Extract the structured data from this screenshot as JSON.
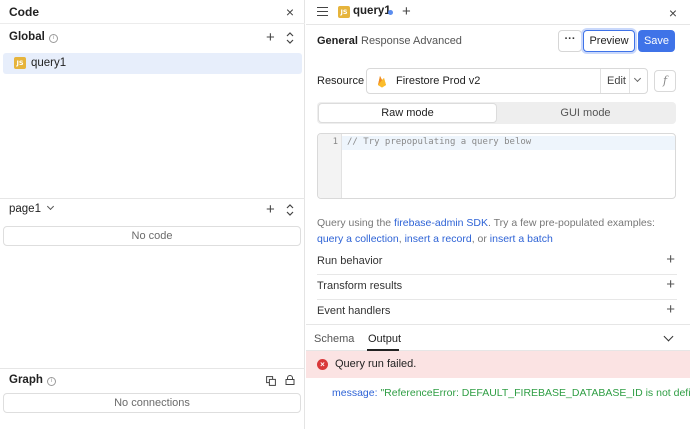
{
  "left_panel": {
    "title": "Code",
    "close_glyph": "×",
    "global_section": {
      "label": "Global",
      "info_glyph": "i"
    },
    "global_items": [
      {
        "badge": "JS",
        "label": "query1"
      }
    ],
    "page_section": {
      "label": "page1",
      "empty_text": "No code"
    },
    "graph_section": {
      "label": "Graph",
      "info_glyph": "i",
      "empty_text": "No connections"
    },
    "plus_glyph": "+"
  },
  "query_editor": {
    "tab": {
      "badge": "JS",
      "label": "query1",
      "add_glyph": "+",
      "close_glyph": "×"
    },
    "subtabs": [
      "General",
      "Response",
      "Advanced"
    ],
    "active_subtab": "General",
    "more_label": "···",
    "preview_label": "Preview",
    "save_label": "Save",
    "resource": {
      "label": "Resource",
      "name": "Firestore Prod v2",
      "edit_label": "Edit",
      "fx_glyph": "f"
    },
    "modes": [
      "Raw mode",
      "GUI mode"
    ],
    "active_mode": "Raw mode",
    "editor": {
      "line_number": "1",
      "code": "// Try prepopulating a query below"
    },
    "help": {
      "prefix": "Query using the ",
      "sdk_link": "firebase-admin SDK",
      "middle": ". Try a few pre-populated examples:",
      "example1": "query a collection",
      "sep1": ", ",
      "example2": "insert a record",
      "sep2": ", or ",
      "example3": "insert a batch"
    },
    "sections": [
      "Run behavior",
      "Transform results",
      "Event handlers"
    ],
    "section_plus_glyph": "+"
  },
  "output": {
    "tabs": [
      "Schema",
      "Output"
    ],
    "active_tab": "Output",
    "error_glyph": "×",
    "status": "Query run failed.",
    "message_key": "message:",
    "message_value": "\"ReferenceError: DEFAULT_FIREBASE_DATABASE_ID is not defined\""
  },
  "colors": {
    "accent": "#3f73e8",
    "selection": "#e7eefb",
    "js_badge": "#e6b43c",
    "error_bg": "#fbe3e3",
    "error": "#d9383a",
    "link": "#2e63d6",
    "string": "#2f9e44"
  },
  "icons": [
    "close-icon",
    "info-icon",
    "plus-icon",
    "sort-icon",
    "chevron-down-icon",
    "menu-icon",
    "firebase-icon",
    "fx-icon",
    "copy-icon",
    "lock-icon",
    "error-icon"
  ]
}
